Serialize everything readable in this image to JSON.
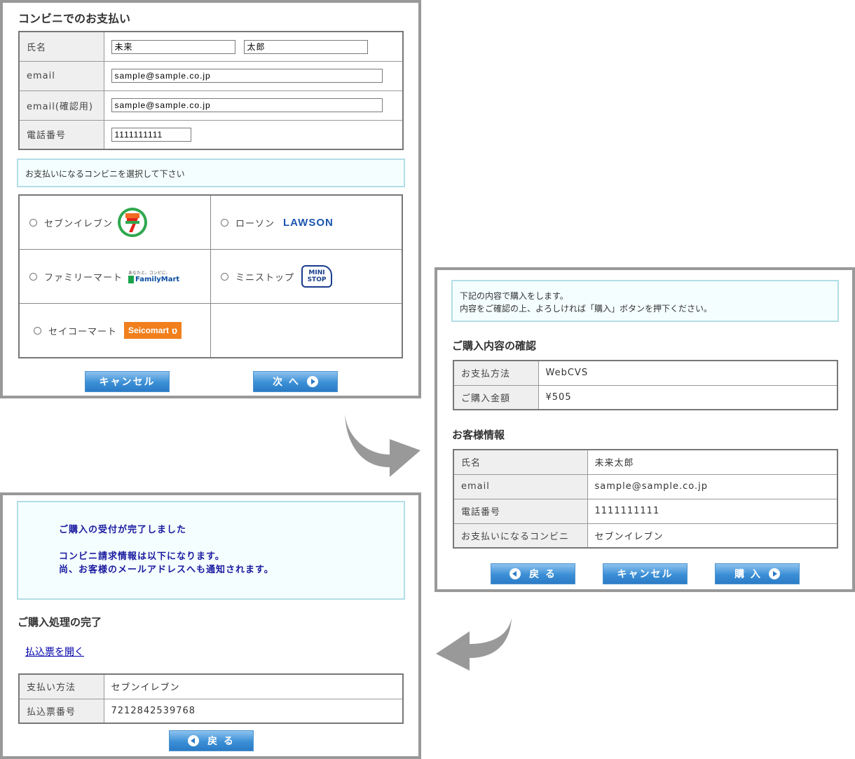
{
  "panel1": {
    "title": "コンビニでのお支払い",
    "fields": [
      {
        "label": "氏名",
        "values": [
          "未来",
          "太郎"
        ]
      },
      {
        "label": "email",
        "values": [
          "sample@sample.co.jp"
        ]
      },
      {
        "label": "email(確認用)",
        "values": [
          "sample@sample.co.jp"
        ]
      },
      {
        "label": "電話番号",
        "values": [
          "1111111111"
        ]
      }
    ],
    "notice": "お支払いになるコンビニを選択して下さい",
    "stores": [
      {
        "name": "セブンイレブン",
        "logo": "seven-eleven-logo"
      },
      {
        "name": "ローソン",
        "logo_text": "LAWSON"
      },
      {
        "name": "ファミリーマート",
        "logo_tag": "あなたと、コンビに、",
        "logo_text": "FamilyMart"
      },
      {
        "name": "ミニストップ",
        "logo_text_1": "MINI",
        "logo_text_2": "STOP"
      },
      {
        "name": "セイコーマート",
        "logo_text": "Seicomart"
      }
    ],
    "cancel_label": "キャンセル",
    "next_label": "次 へ"
  },
  "panel2": {
    "notice_line1": "下記の内容で購入をします。",
    "notice_line2": "内容をご確認の上、よろしければ「購入」ボタンを押下ください。",
    "section1_title": "ご購入内容の確認",
    "order": [
      {
        "label": "お支払方法",
        "value": "WebCVS"
      },
      {
        "label": "ご購入金額",
        "value": "¥505"
      }
    ],
    "section2_title": "お客様情報",
    "customer": [
      {
        "label": "氏名",
        "value": "未来太郎"
      },
      {
        "label": "email",
        "value": "sample@sample.co.jp"
      },
      {
        "label": "電話番号",
        "value": "1111111111"
      },
      {
        "label": "お支払いになるコンビニ",
        "value": "セブンイレブン"
      }
    ],
    "back_label": "戻 る",
    "cancel_label": "キャンセル",
    "purchase_label": "購 入"
  },
  "panel3": {
    "msg_line1": "ご購入の受付が完了しました",
    "msg_line2": "コンビニ請求情報は以下になります。",
    "msg_line3": "尚、お客様のメールアドレスへも通知されます。",
    "section_title": "ご購入処理の完了",
    "link_label": "払込票を開く",
    "rows": [
      {
        "label": "支払い方法",
        "value": "セブンイレブン"
      },
      {
        "label": "払込票番号",
        "value": "7212842539768"
      }
    ],
    "back_label": "戻 る"
  },
  "colors": {
    "button": "#3b8fd6",
    "notice_bg": "#f4fefe",
    "notice_border": "#b3dde6",
    "flow_arrow": "#999999",
    "done_text": "#1a1aa0"
  }
}
